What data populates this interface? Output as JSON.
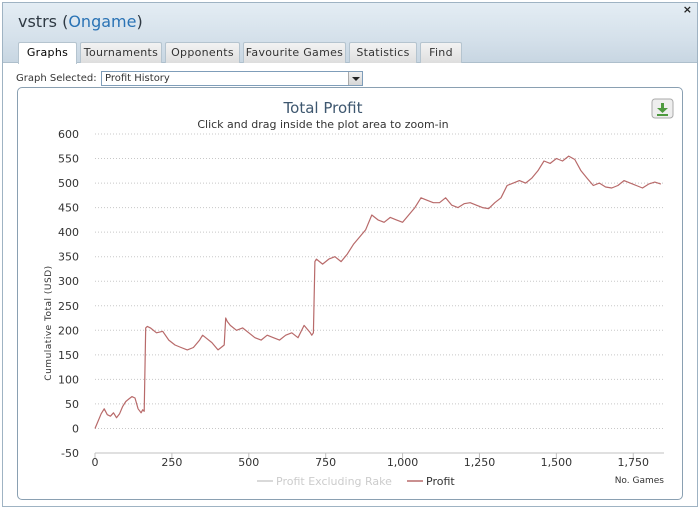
{
  "window": {
    "title_prefix": "vstrs (",
    "title_network": "Ongame",
    "title_suffix": ")",
    "close_label": "×"
  },
  "tabs": [
    {
      "label": "Graphs",
      "active": true
    },
    {
      "label": "Tournaments",
      "active": false
    },
    {
      "label": "Opponents",
      "active": false
    },
    {
      "label": "Favourite Games",
      "active": false
    },
    {
      "label": "Statistics",
      "active": false
    },
    {
      "label": "Find",
      "active": false
    }
  ],
  "graph_select": {
    "label": "Graph Selected:",
    "value": "Profit History"
  },
  "chart_data": {
    "type": "line",
    "title": "Total Profit",
    "subtitle": "Click and drag inside the plot area to zoom-in",
    "xlabel": "No. Games",
    "ylabel": "Cumulative Total (USD)",
    "xlim": [
      0,
      1850
    ],
    "ylim": [
      -50,
      600
    ],
    "x_ticks": [
      0,
      250,
      500,
      750,
      1000,
      1250,
      1500,
      1750
    ],
    "x_tick_labels": [
      "0",
      "250",
      "500",
      "750",
      "1,000",
      "1,250",
      "1,500",
      "1,750"
    ],
    "y_ticks": [
      -50,
      0,
      50,
      100,
      150,
      200,
      250,
      300,
      350,
      400,
      450,
      500,
      550,
      600
    ],
    "y_tick_labels": [
      "-50",
      "0",
      "50",
      "100",
      "150",
      "200",
      "250",
      "300",
      "350",
      "400",
      "450",
      "500",
      "550",
      "600"
    ],
    "grid": true,
    "legend_position": "bottom-center",
    "series": [
      {
        "name": "Profit Excluding Rake",
        "color": "#cccccc",
        "visible": false,
        "x": [],
        "y": []
      },
      {
        "name": "Profit",
        "color": "#b86a6a",
        "visible": true,
        "x": [
          0,
          10,
          20,
          30,
          40,
          50,
          60,
          70,
          80,
          90,
          100,
          110,
          120,
          130,
          140,
          150,
          155,
          160,
          165,
          170,
          180,
          200,
          220,
          240,
          260,
          280,
          300,
          320,
          340,
          350,
          360,
          380,
          400,
          410,
          420,
          425,
          430,
          440,
          460,
          480,
          500,
          520,
          540,
          560,
          580,
          600,
          620,
          640,
          660,
          680,
          700,
          705,
          710,
          715,
          720,
          740,
          760,
          780,
          800,
          820,
          840,
          860,
          880,
          900,
          920,
          940,
          960,
          980,
          1000,
          1020,
          1040,
          1060,
          1080,
          1100,
          1120,
          1140,
          1160,
          1180,
          1200,
          1220,
          1240,
          1260,
          1280,
          1300,
          1320,
          1340,
          1360,
          1380,
          1400,
          1420,
          1440,
          1460,
          1480,
          1500,
          1520,
          1540,
          1560,
          1580,
          1600,
          1620,
          1640,
          1660,
          1680,
          1700,
          1720,
          1740,
          1760,
          1780,
          1800,
          1820,
          1840
        ],
        "y": [
          0,
          15,
          30,
          40,
          28,
          25,
          32,
          22,
          30,
          45,
          55,
          60,
          65,
          62,
          40,
          32,
          38,
          35,
          205,
          208,
          205,
          195,
          198,
          180,
          170,
          165,
          160,
          165,
          180,
          190,
          185,
          175,
          160,
          165,
          170,
          225,
          218,
          210,
          200,
          205,
          195,
          185,
          180,
          190,
          185,
          180,
          190,
          195,
          185,
          210,
          195,
          190,
          195,
          340,
          345,
          335,
          345,
          350,
          340,
          355,
          375,
          390,
          405,
          435,
          425,
          420,
          430,
          425,
          420,
          435,
          450,
          470,
          465,
          460,
          460,
          470,
          455,
          450,
          458,
          460,
          455,
          450,
          448,
          460,
          470,
          495,
          500,
          505,
          500,
          510,
          525,
          545,
          540,
          550,
          545,
          555,
          548,
          525,
          510,
          495,
          500,
          492,
          490,
          495,
          505,
          500,
          495,
          490,
          498,
          502,
          498
        ]
      }
    ]
  }
}
